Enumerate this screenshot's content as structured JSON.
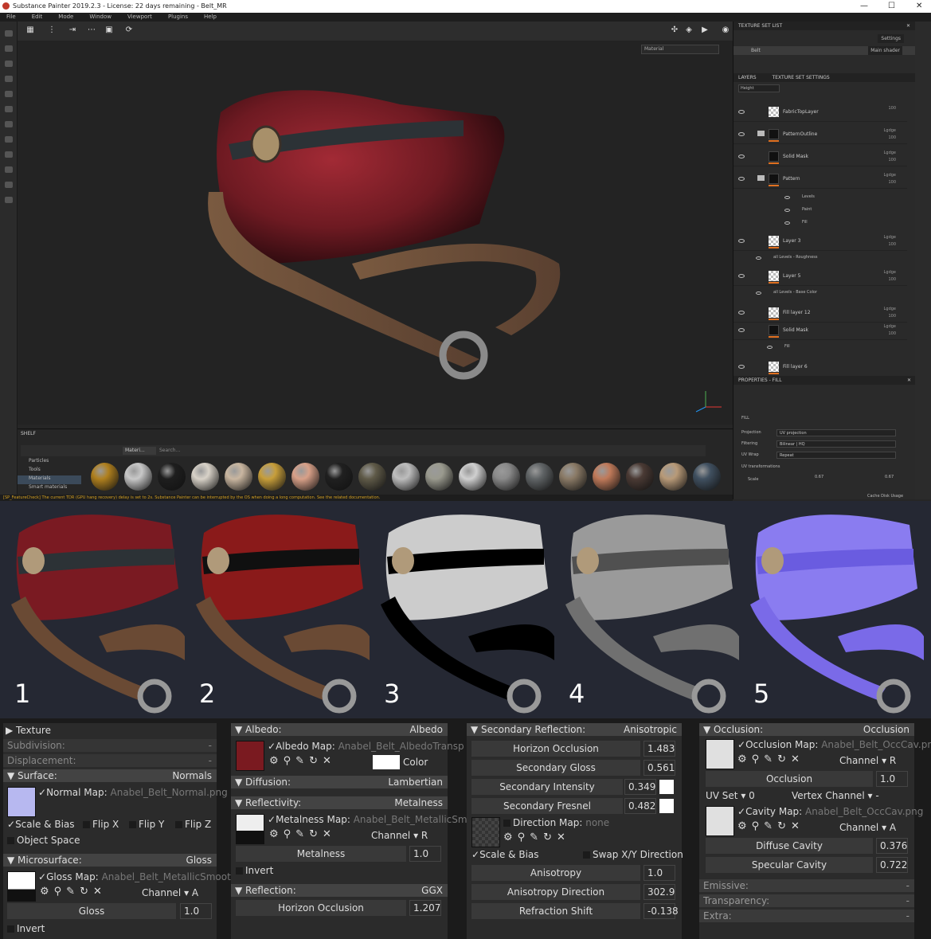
{
  "window": {
    "title": "Substance Painter 2019.2.3 - License: 22 days remaining - Belt_MR",
    "controls": [
      "—",
      "☐",
      "✕"
    ]
  },
  "menu": [
    "File",
    "Edit",
    "Mode",
    "Window",
    "Viewport",
    "Plugins",
    "Help"
  ],
  "viewport": {
    "dropdown": "Material"
  },
  "shelf": {
    "title": "SHELF",
    "categories": [
      "Particles",
      "Tools",
      "Materials",
      "Smart materials"
    ],
    "active_tab": "Materi...",
    "search_placeholder": "Search..."
  },
  "status": "[SP_FeatureCheck] The current TDR (GPU hang recovery) delay is set to 2s. Substance Painter can be interrupted by the OS when doing a long computation. See the related documentation.",
  "texture_set_list": {
    "title": "TEXTURE SET LIST",
    "settings": "Settings",
    "set_name": "Belt",
    "shader": "Main shader"
  },
  "layers": {
    "tab1": "LAYERS",
    "tab2": "TEXTURE SET SETTINGS",
    "channel": "Height",
    "items": [
      {
        "name": "FabricTopLayer",
        "r1": "100",
        "r2": ""
      },
      {
        "name": "PatternOutline",
        "r1": "Lgdge",
        "r2": "100"
      },
      {
        "name": "Solid Mask",
        "r1": "Lgdge",
        "r2": "100"
      },
      {
        "name": "Pattern",
        "r1": "Lgdge",
        "r2": "100"
      },
      {
        "name": "Layer 3",
        "r1": "Lgdge",
        "r2": "100"
      },
      {
        "name": "Layer 5",
        "r1": "Lgdge",
        "r2": "100"
      },
      {
        "name": "Fill layer 12",
        "r1": "Lgdge",
        "r2": "100"
      },
      {
        "name": "Solid Mask",
        "r1": "Lgdge",
        "r2": "100"
      },
      {
        "name": "Fill layer 6",
        "r1": "",
        "r2": ""
      }
    ],
    "subs": [
      "Levels",
      "Paint",
      "Fill",
      "all Levels - Roughness",
      "all Levels - Base Color",
      "Fill"
    ]
  },
  "properties": {
    "title": "PROPERTIES - FILL",
    "section": "FILL",
    "projection_label": "Projection",
    "projection": "UV projection",
    "filtering_label": "Filtering",
    "filtering": "Bilinear | HQ",
    "uvwrap_label": "UV Wrap",
    "uvwrap": "Repeat",
    "uvtrans": "UV transformations",
    "scale_label": "Scale",
    "scale": "0.67",
    "scale2": "0.67",
    "cache": "Cache Disk Usage"
  },
  "renders": [
    {
      "label": "1"
    },
    {
      "label": "2"
    },
    {
      "label": "3"
    },
    {
      "label": "4"
    },
    {
      "label": "5"
    }
  ],
  "panel1": {
    "texture": "Texture",
    "subdivision": "Subdivision:",
    "displacement": "Displacement:",
    "surface": "Surface:",
    "surface_val": "Normals",
    "normal_map": "Normal Map:",
    "normal_file": "Anabel_Belt_Normal.png",
    "scale_bias": "Scale & Bias",
    "flipx": "Flip X",
    "flipy": "Flip Y",
    "flipz": "Flip Z",
    "object_space": "Object Space",
    "micro": "Microsurface:",
    "micro_val": "Gloss",
    "gloss_map": "Gloss Map:",
    "gloss_file": "Anabel_Belt_MetallicSmooth",
    "channel": "Channel",
    "channel_val": "A",
    "gloss": "Gloss",
    "gloss_num": "1.0",
    "invert": "Invert",
    "dash": "-"
  },
  "panel2": {
    "albedo": "Albedo:",
    "albedo_val": "Albedo",
    "albedo_map": "Albedo Map:",
    "albedo_file": "Anabel_Belt_AlbedoTransp",
    "color": "Color",
    "diffusion": "Diffusion:",
    "diffusion_val": "Lambertian",
    "reflectivity": "Reflectivity:",
    "reflectivity_val": "Metalness",
    "metal_map": "Metalness Map:",
    "metal_file": "Anabel_Belt_MetallicSm",
    "channel": "Channel",
    "channel_val": "R",
    "metalness": "Metalness",
    "metal_num": "1.0",
    "invert": "Invert",
    "reflection": "Reflection:",
    "reflection_val": "GGX",
    "horizon": "Horizon Occlusion",
    "horizon_num": "1.207"
  },
  "panel3": {
    "sec": "Secondary Reflection:",
    "sec_val": "Anisotropic",
    "horizon": "Horizon Occlusion",
    "horizon_num": "1.483",
    "gloss": "Secondary Gloss",
    "gloss_num": "0.561",
    "intensity": "Secondary Intensity",
    "intensity_num": "0.349",
    "fresnel": "Secondary Fresnel",
    "fresnel_num": "0.482",
    "dir_map": "Direction Map:",
    "dir_val": "none",
    "scale_bias": "Scale & Bias",
    "swap": "Swap X/Y Direction",
    "aniso": "Anisotropy",
    "aniso_num": "1.0",
    "aniso_dir": "Anisotropy Direction",
    "aniso_dir_num": "302.9",
    "refr": "Refraction Shift",
    "refr_num": "-0.138"
  },
  "panel4": {
    "occ": "Occlusion:",
    "occ_val": "Occlusion",
    "occ_map": "Occlusion Map:",
    "occ_file": "Anabel_Belt_OccCav.png",
    "channel": "Channel",
    "ch_r": "R",
    "occlusion": "Occlusion",
    "occ_num": "1.0",
    "uvset": "UV Set",
    "uvset_val": "0",
    "vertex": "Vertex Channel",
    "vertex_val": "-",
    "cav_map": "Cavity Map:",
    "cav_file": "Anabel_Belt_OccCav.png",
    "ch_a": "A",
    "diffuse": "Diffuse Cavity",
    "diffuse_num": "0.376",
    "specular": "Specular Cavity",
    "specular_num": "0.722",
    "emissive": "Emissive:",
    "transparency": "Transparency:",
    "extra": "Extra:",
    "dash": "-"
  }
}
